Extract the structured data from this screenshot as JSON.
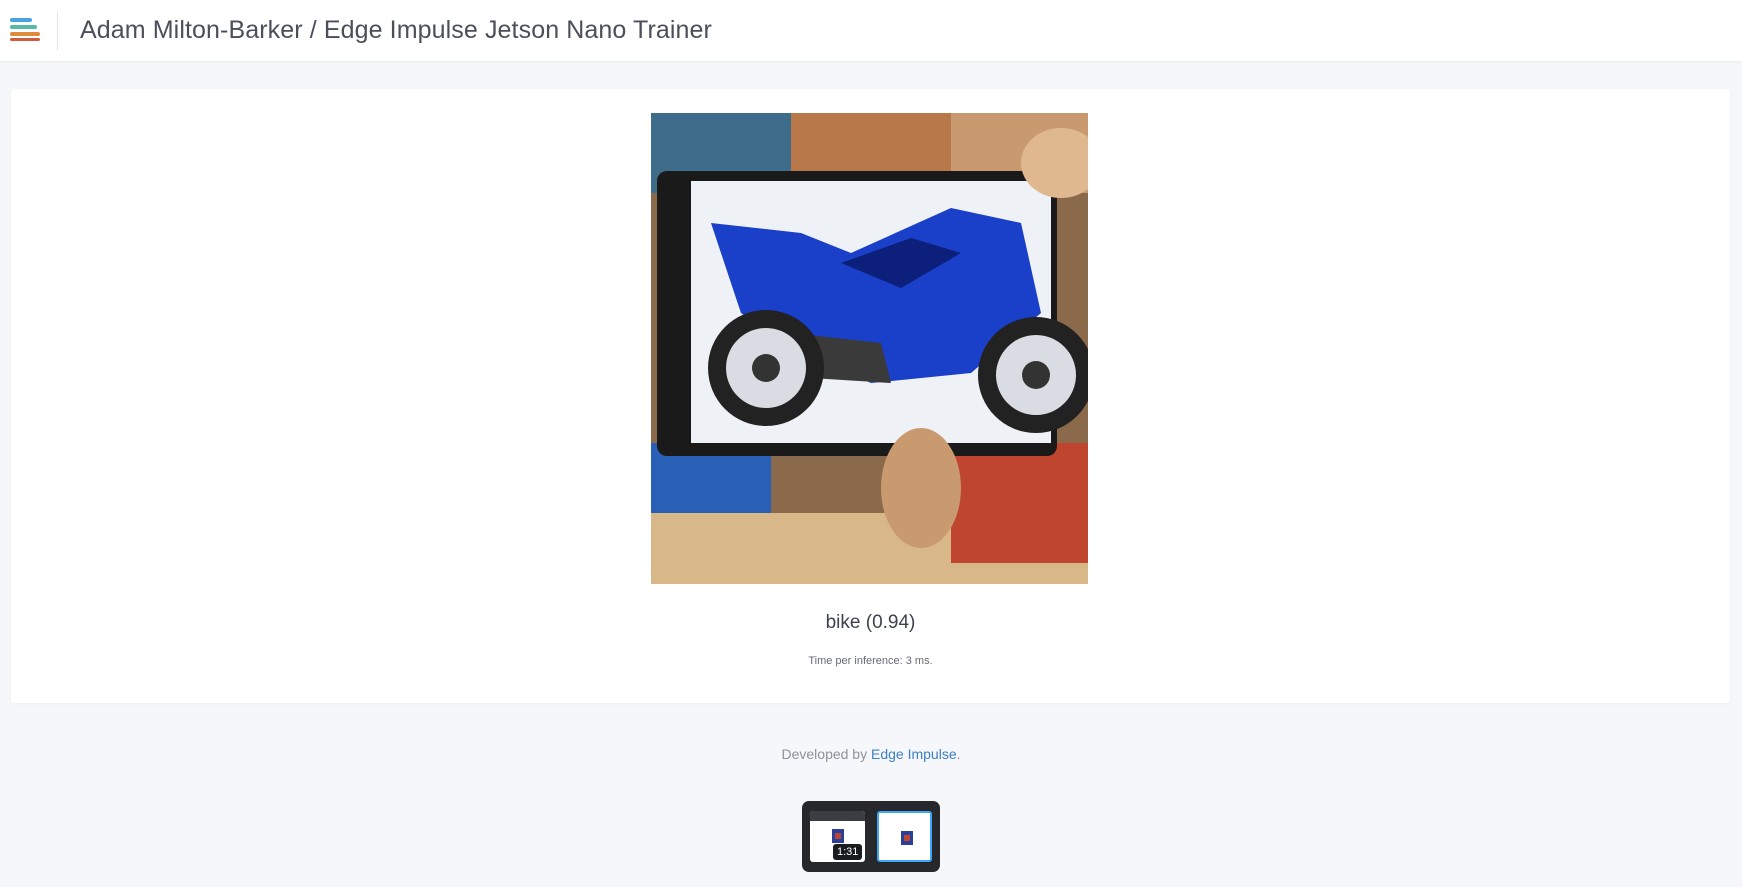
{
  "header": {
    "logo_icon": "edge-impulse-logo-icon",
    "title": "Adam Milton-Barker / Edge Impulse Jetson Nano Trainer"
  },
  "classification": {
    "image_alt": "Camera frame showing a phone displaying a blue motorcycle",
    "result": "bike (0.94)",
    "timing": "Time per inference: 3 ms."
  },
  "footer": {
    "prefix": "Developed by ",
    "link_text": "Edge Impulse",
    "suffix": "."
  },
  "thumbnails": {
    "time_badge": "1:31"
  },
  "colors": {
    "accent_link": "#3f7fc7",
    "selected_thumb_border": "#3fa7f5"
  }
}
